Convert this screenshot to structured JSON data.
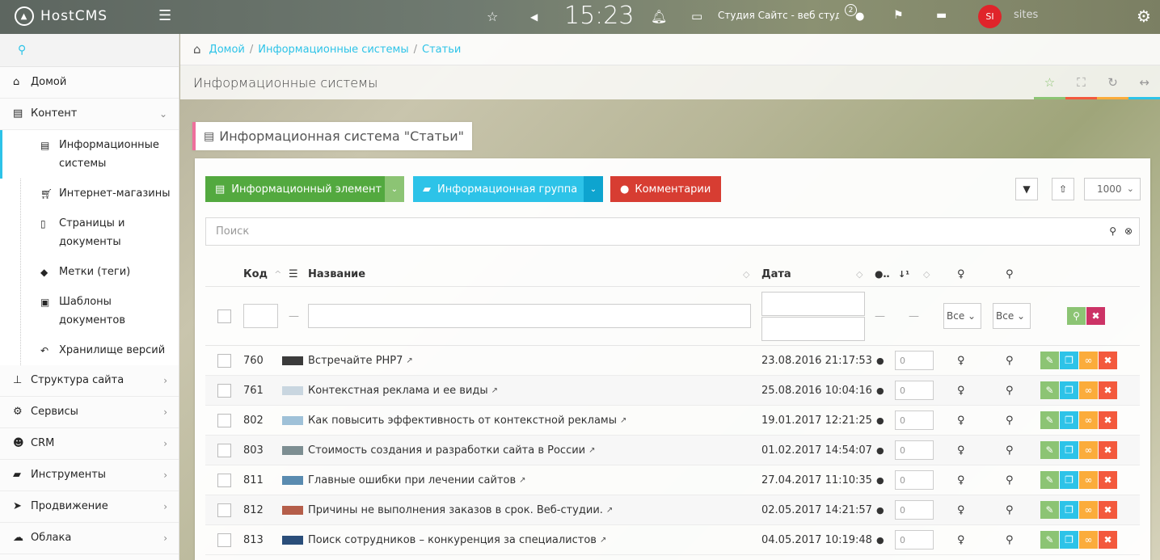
{
  "topbar": {
    "logo": "HostCMS",
    "clock": "15:23",
    "site": "Студия Сайтс - веб студия",
    "notif_count": "2",
    "avatar": "SI",
    "user": "sites"
  },
  "sidebar": {
    "items": [
      {
        "label": "Домой",
        "icon": "home-icon"
      },
      {
        "label": "Контент",
        "icon": "newspaper-icon",
        "expanded": true
      }
    ],
    "sub": [
      {
        "label": "Информационные системы",
        "icon": "newspaper-icon",
        "active": true
      },
      {
        "label": "Интернет-магазины",
        "icon": "cart-icon"
      },
      {
        "label": "Страницы и документы",
        "icon": "file-icon"
      },
      {
        "label": "Метки (теги)",
        "icon": "tags-icon"
      },
      {
        "label": "Шаблоны документов",
        "icon": "word-file-icon"
      },
      {
        "label": "Хранилище версий",
        "icon": "reply-all-icon"
      }
    ],
    "bottom": [
      {
        "label": "Структура сайта",
        "icon": "sitemap-icon"
      },
      {
        "label": "Сервисы",
        "icon": "cogs-icon"
      },
      {
        "label": "CRM",
        "icon": "users-icon"
      },
      {
        "label": "Инструменты",
        "icon": "briefcase-icon"
      },
      {
        "label": "Продвижение",
        "icon": "rocket-icon"
      },
      {
        "label": "Облака",
        "icon": "cloud-icon"
      }
    ]
  },
  "breadcrumb": {
    "items": [
      "Домой",
      "Информационные системы",
      "Статьи"
    ]
  },
  "page": {
    "title": "Информационные системы",
    "widget_title": "Информационная система \"Статьи\""
  },
  "toolbar": {
    "btn_element": "Информационный элемент",
    "btn_group": "Информационная группа",
    "btn_comments": "Комментарии",
    "per_page": "1000",
    "search_placeholder": "Поиск"
  },
  "table": {
    "headers": {
      "code": "Код",
      "name": "Название",
      "date": "Дата"
    },
    "filter_select": "Все",
    "rows": [
      {
        "code": "760",
        "name": "Встречайте PHP7",
        "date": "23.08.2016 21:17:53",
        "count": "0"
      },
      {
        "code": "761",
        "name": "Контекстная реклама и ее виды",
        "date": "25.08.2016 10:04:16",
        "count": "0"
      },
      {
        "code": "802",
        "name": "Как повысить эффективность от контекстной рекламы",
        "date": "19.01.2017 12:21:25",
        "count": "0"
      },
      {
        "code": "803",
        "name": "Стоимость создания и разработки сайта в России",
        "date": "01.02.2017 14:54:07",
        "count": "0"
      },
      {
        "code": "811",
        "name": "Главные ошибки при лечении сайтов",
        "date": "27.04.2017 11:10:35",
        "count": "0"
      },
      {
        "code": "812",
        "name": "Причины не выполнения заказов в срок. Веб-студии.",
        "date": "02.05.2017 14:21:57",
        "count": "0"
      },
      {
        "code": "813",
        "name": "Поиск сотрудников – конкуренция за специалистов",
        "date": "04.05.2017 10:19:48",
        "count": "0"
      }
    ]
  }
}
